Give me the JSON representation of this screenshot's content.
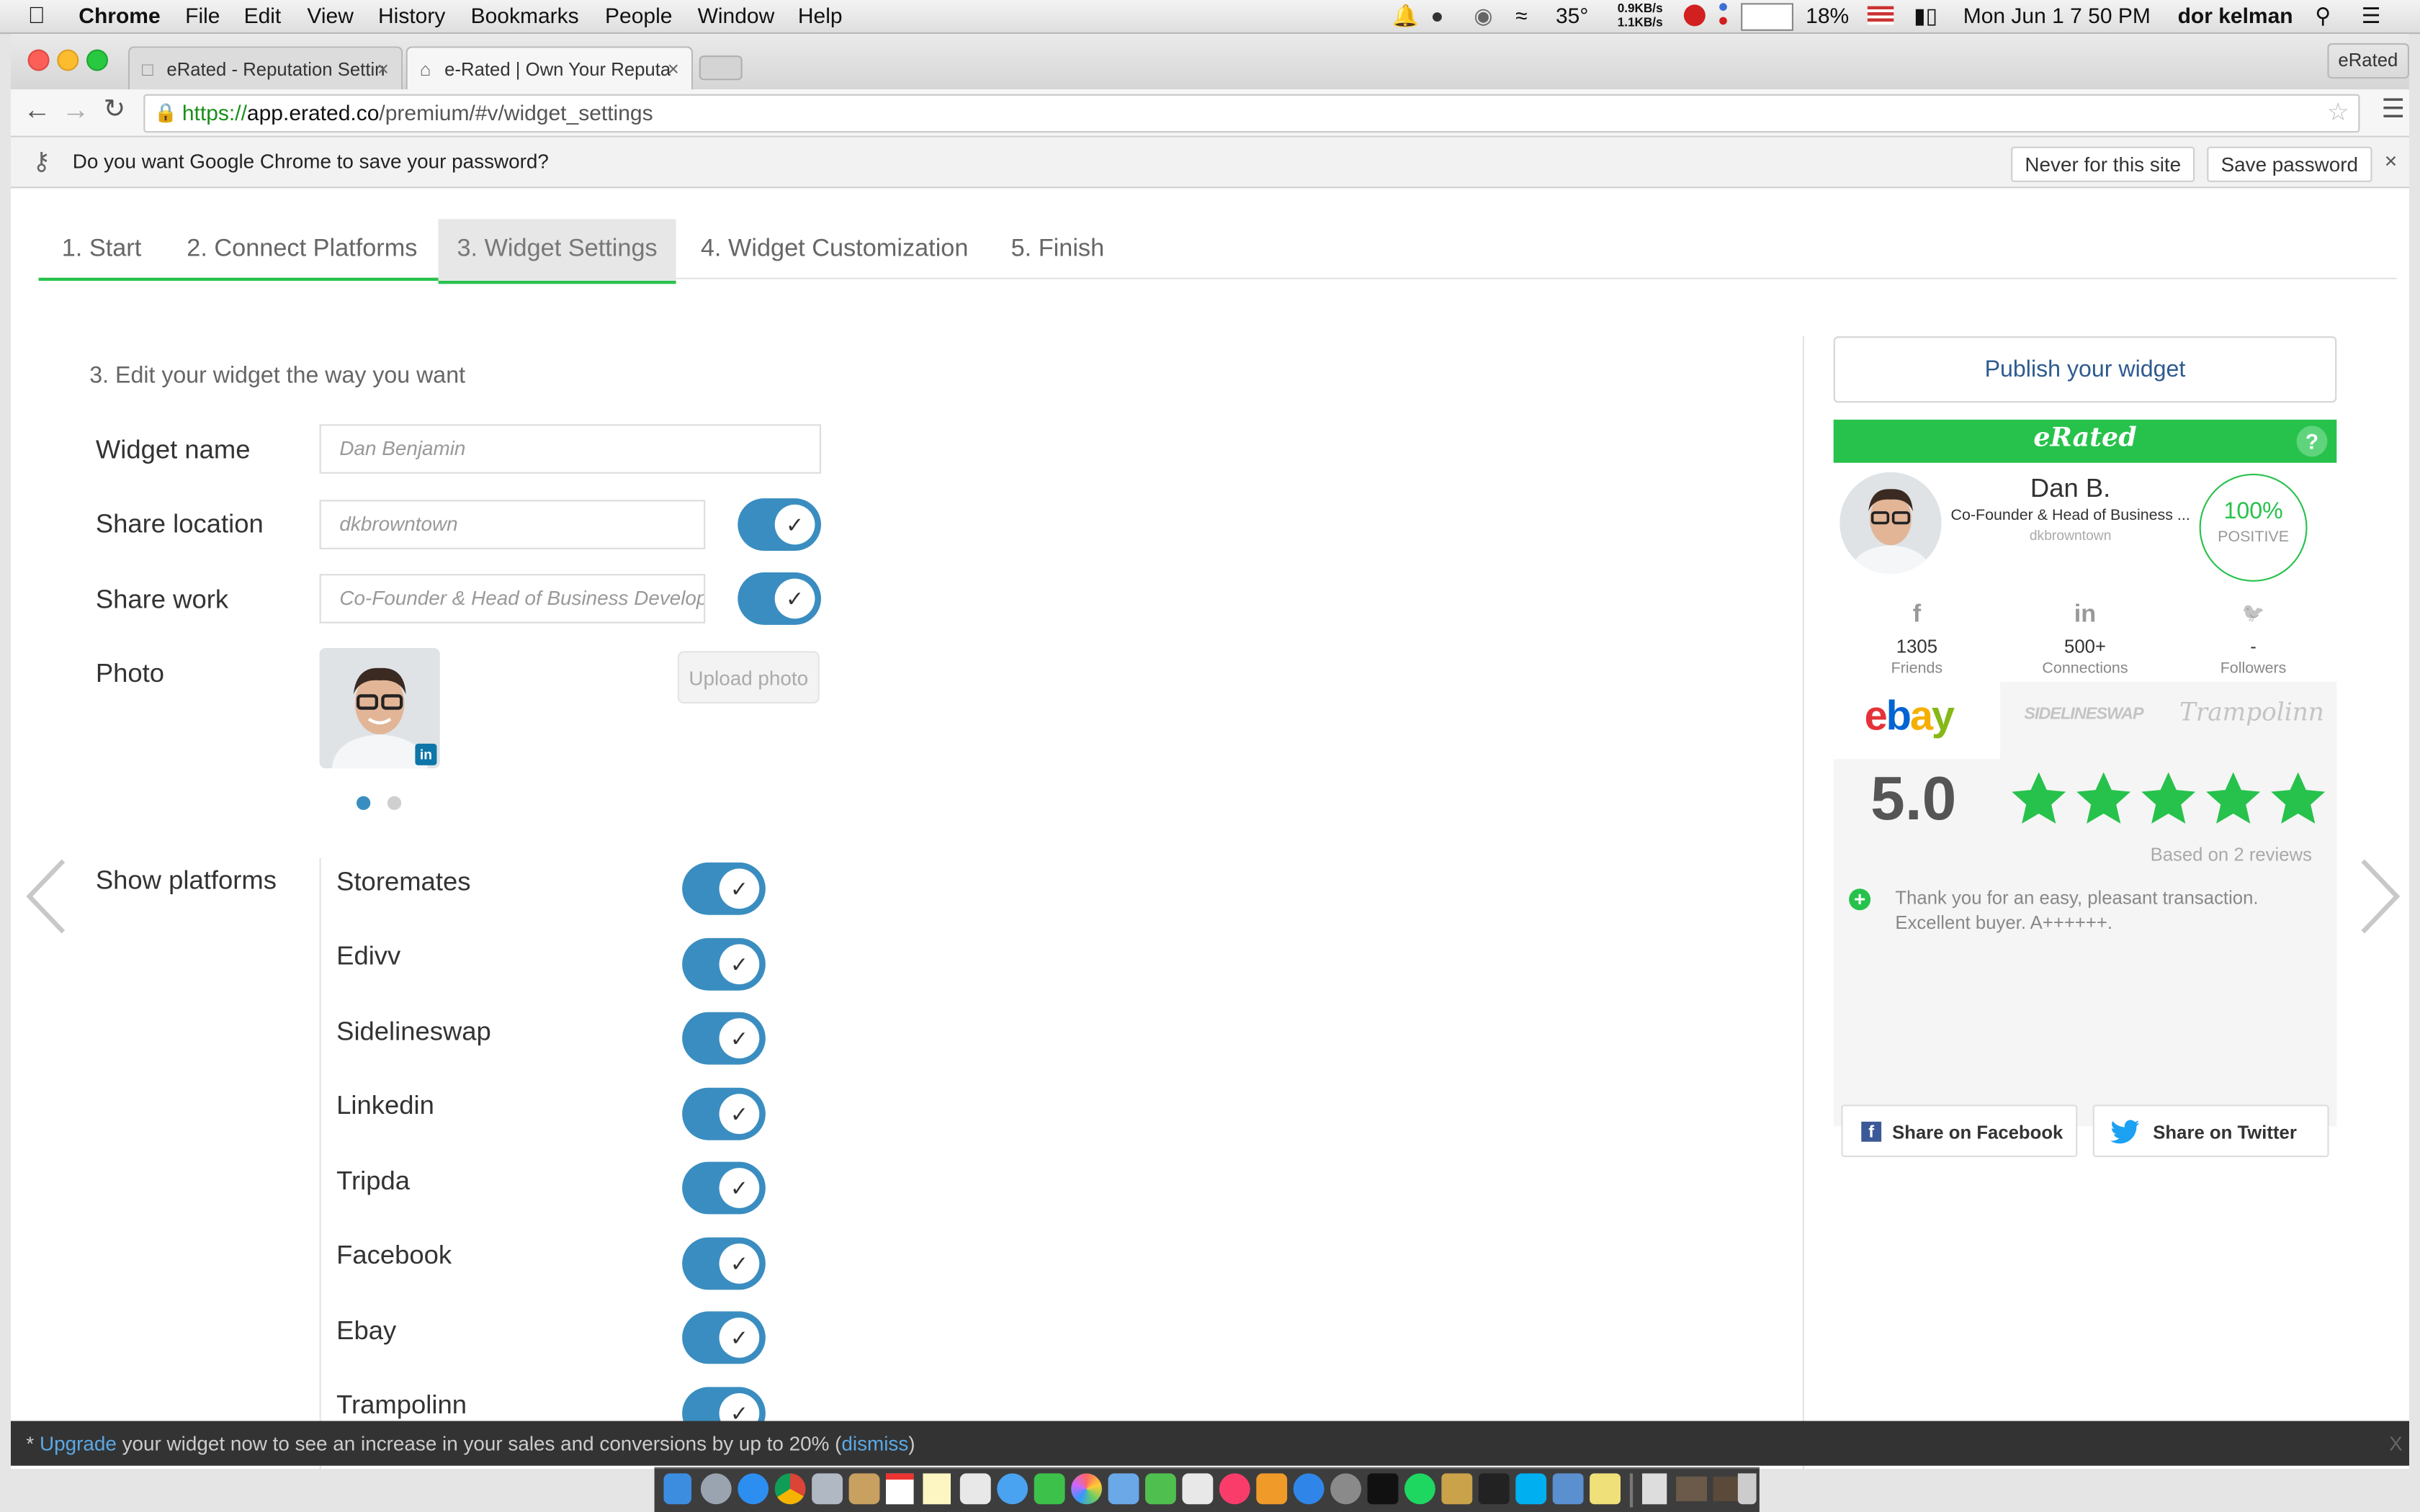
{
  "menubar": {
    "app_name": "Chrome",
    "items": [
      "File",
      "Edit",
      "View",
      "History",
      "Bookmarks",
      "People",
      "Window",
      "Help"
    ],
    "status": {
      "temperature": "35°",
      "net_up": "0.9KB/s",
      "net_down": "1.1KB/s",
      "battery": "18%",
      "datetime": "Mon Jun 1  7 50 PM",
      "user": "dor kelman"
    }
  },
  "browser": {
    "tabs": [
      {
        "title": "eRated - Reputation Settin"
      },
      {
        "title": "e-Rated | Own Your Reputa"
      }
    ],
    "profile": "eRated",
    "url": {
      "scheme": "https://",
      "host": "app.erated.co",
      "path": "/premium/#v/widget_settings"
    },
    "infobar": {
      "message": "Do you want Google Chrome to save your password?",
      "never_label": "Never for this site",
      "save_label": "Save password"
    }
  },
  "steps": [
    {
      "label": "1. Start"
    },
    {
      "label": "2. Connect Platforms"
    },
    {
      "label": "3. Widget Settings"
    },
    {
      "label": "4. Widget Customization"
    },
    {
      "label": "5. Finish"
    }
  ],
  "form": {
    "heading": "3. Edit your widget the way you want",
    "widget_name": {
      "label": "Widget name",
      "placeholder": "Dan Benjamin"
    },
    "share_location": {
      "label": "Share location",
      "placeholder": "dkbrowntown",
      "enabled": true
    },
    "share_work": {
      "label": "Share work",
      "placeholder": "Co-Founder & Head of Business Develop",
      "enabled": true
    },
    "photo": {
      "label": "Photo",
      "upload_label": "Upload photo"
    },
    "show_platforms_label": "Show platforms",
    "platforms": [
      {
        "name": "Storemates",
        "enabled": true
      },
      {
        "name": "Edivv",
        "enabled": true
      },
      {
        "name": "Sidelineswap",
        "enabled": true
      },
      {
        "name": "Linkedin",
        "enabled": true
      },
      {
        "name": "Tripda",
        "enabled": true
      },
      {
        "name": "Facebook",
        "enabled": true
      },
      {
        "name": "Ebay",
        "enabled": true
      },
      {
        "name": "Trampolinn",
        "enabled": true
      }
    ]
  },
  "widget": {
    "publish_label": "Publish your widget",
    "brand": "eRated",
    "help_icon": "?",
    "name": "Dan B.",
    "title": "Co-Founder & Head of Business ...",
    "location": "dkbrowntown",
    "positive_pct": "100%",
    "positive_label": "POSITIVE",
    "social": [
      {
        "icon": "f",
        "count": "1305",
        "label": "Friends"
      },
      {
        "icon": "in",
        "count": "500+",
        "label": "Connections"
      },
      {
        "icon": "🐦",
        "count": "-",
        "label": "Followers"
      }
    ],
    "platform_logos": [
      "ebay",
      "SIDELINESWAP",
      "Trampolinn"
    ],
    "score": "5.0",
    "stars": 5,
    "based_on": "Based on 2 reviews",
    "review_text": "Thank you for an easy, pleasant transaction. Excellent buyer. A++++++.",
    "share_facebook": "Share on Facebook",
    "share_twitter": "Share on Twitter"
  },
  "banner": {
    "prefix": "* ",
    "upgrade": "Upgrade",
    "text": " your widget now to see an increase in your sales and conversions by up to 20% (",
    "dismiss": "dismiss",
    "suffix": ")",
    "close": "X"
  },
  "colors": {
    "accent_green": "#27c24c",
    "toggle_blue": "#3a8dc0",
    "link_blue": "#5aa9e6",
    "publish_text": "#2e5b8f"
  }
}
